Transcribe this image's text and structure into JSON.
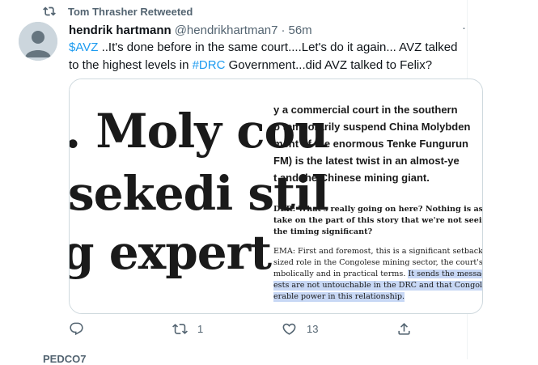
{
  "retweet_banner": {
    "text": "Tom Thrasher Retweeted"
  },
  "tweet": {
    "display_name": "hendrik hartmann",
    "handle": "@hendrikhartman7",
    "separator": "·",
    "time": "56m",
    "more": "·",
    "text_parts": {
      "cashtag": "$AVZ",
      "part1": " ..It's done before in the same court....Let's do it again... AVZ talked to the highest levels in ",
      "hashtag": "#DRC",
      "part2": "  Government...did AVZ talked to Felix?"
    },
    "media": {
      "headline_lines": [
        ". Moly cou",
        "sekedi stil",
        "g expert"
      ],
      "bold_lines": [
        "y a commercial court in the southern",
        "o temporarily suspend China Molybden",
        "ment of the enormous Tenke Fungurun",
        "FM) is the latest twist in an almost-ye",
        "t and the Chinese mining giant."
      ],
      "question_lines": [
        "DER: What's really going on here? Nothing is as it see",
        " take on the part of this story that we're not seeing fro",
        " the timing significant?"
      ],
      "answer_lines": [
        "EMA: First and foremost, this is a significant setback fo",
        "sized role in the Congolese mining sector, the court's ru",
        "mbolically and in practical terms. ",
        "ests are not untouchable in the DRC and that Congolese",
        "erable power in this relationship."
      ],
      "answer_highlight": "It sends the message t"
    },
    "actions": {
      "reply_count": "",
      "retweet_count": "1",
      "like_count": "13"
    }
  },
  "next_tweet_peek": "PEDCO7"
}
